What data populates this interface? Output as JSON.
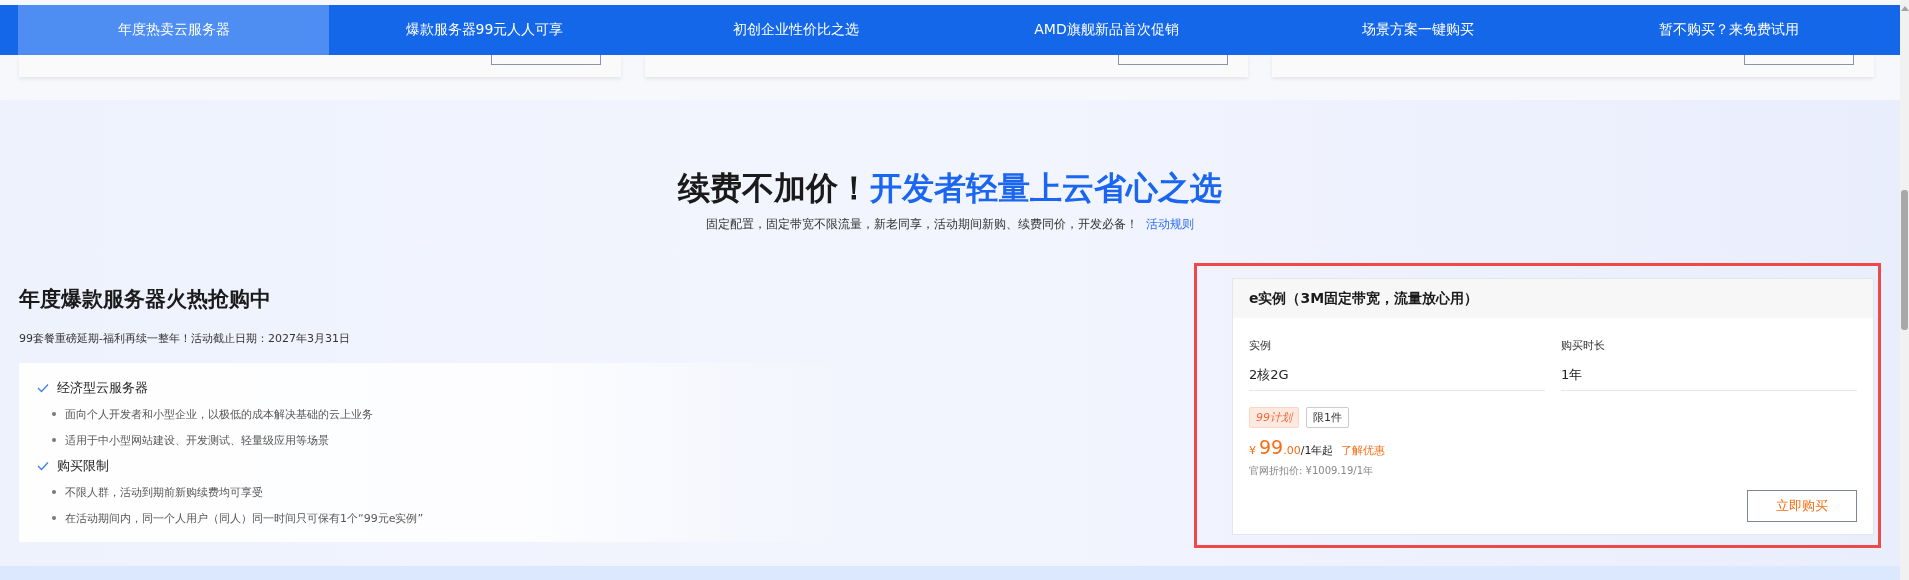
{
  "nav_tabs": [
    {
      "label": "年度热卖云服务器",
      "selected": true
    },
    {
      "label": "爆款服务器99元人人可享",
      "selected": false
    },
    {
      "label": "初创企业性价比之选",
      "selected": false
    },
    {
      "label": "AMD旗舰新品首次促销",
      "selected": false
    },
    {
      "label": "场景方案一键购买",
      "selected": false
    },
    {
      "label": "暂不购买？来免费试用",
      "selected": false
    }
  ],
  "banner": {
    "title_dark": "续费不加价！",
    "title_blue": "开发者轻量上云省心之选",
    "subtitle": "固定配置，固定带宽不限流量，新老同享，活动期间新购、续费同价，开发必备！",
    "rules_link": "活动规则"
  },
  "promo": {
    "title": "年度爆款服务器火热抢购中",
    "subtitle": "99套餐重磅延期-福利再续一整年！活动截止日期：2027年3月31日",
    "features": [
      {
        "heading": "经济型云服务器",
        "points": [
          "面向个人开发者和小型企业，以极低的成本解决基础的云上业务",
          "适用于中小型网站建设、开发测试、轻量级应用等场景"
        ]
      },
      {
        "heading": "购买限制",
        "points": [
          "不限人群，活动到期前新购续费均可享受",
          "在活动期间内，同一个人用户（同人）同一时间只可保有1个“99元e实例”"
        ]
      }
    ]
  },
  "offer": {
    "highlighted": true,
    "title": "e实例（3M固定带宽，流量放心用）",
    "fields": [
      {
        "label": "实例",
        "value": "2核2G"
      },
      {
        "label": "购买时长",
        "value": "1年"
      }
    ],
    "tags": [
      {
        "kind": "plan",
        "label": "99计划"
      },
      {
        "kind": "limit",
        "label": "限1件"
      }
    ],
    "currency": "¥",
    "price_int": "99",
    "price_dec": ".00",
    "price_unit": "/1年起",
    "discount_link": "了解优惠",
    "list_price": "官网折扣价: ¥1009.19/1年",
    "buy_button": "立即购买"
  }
}
